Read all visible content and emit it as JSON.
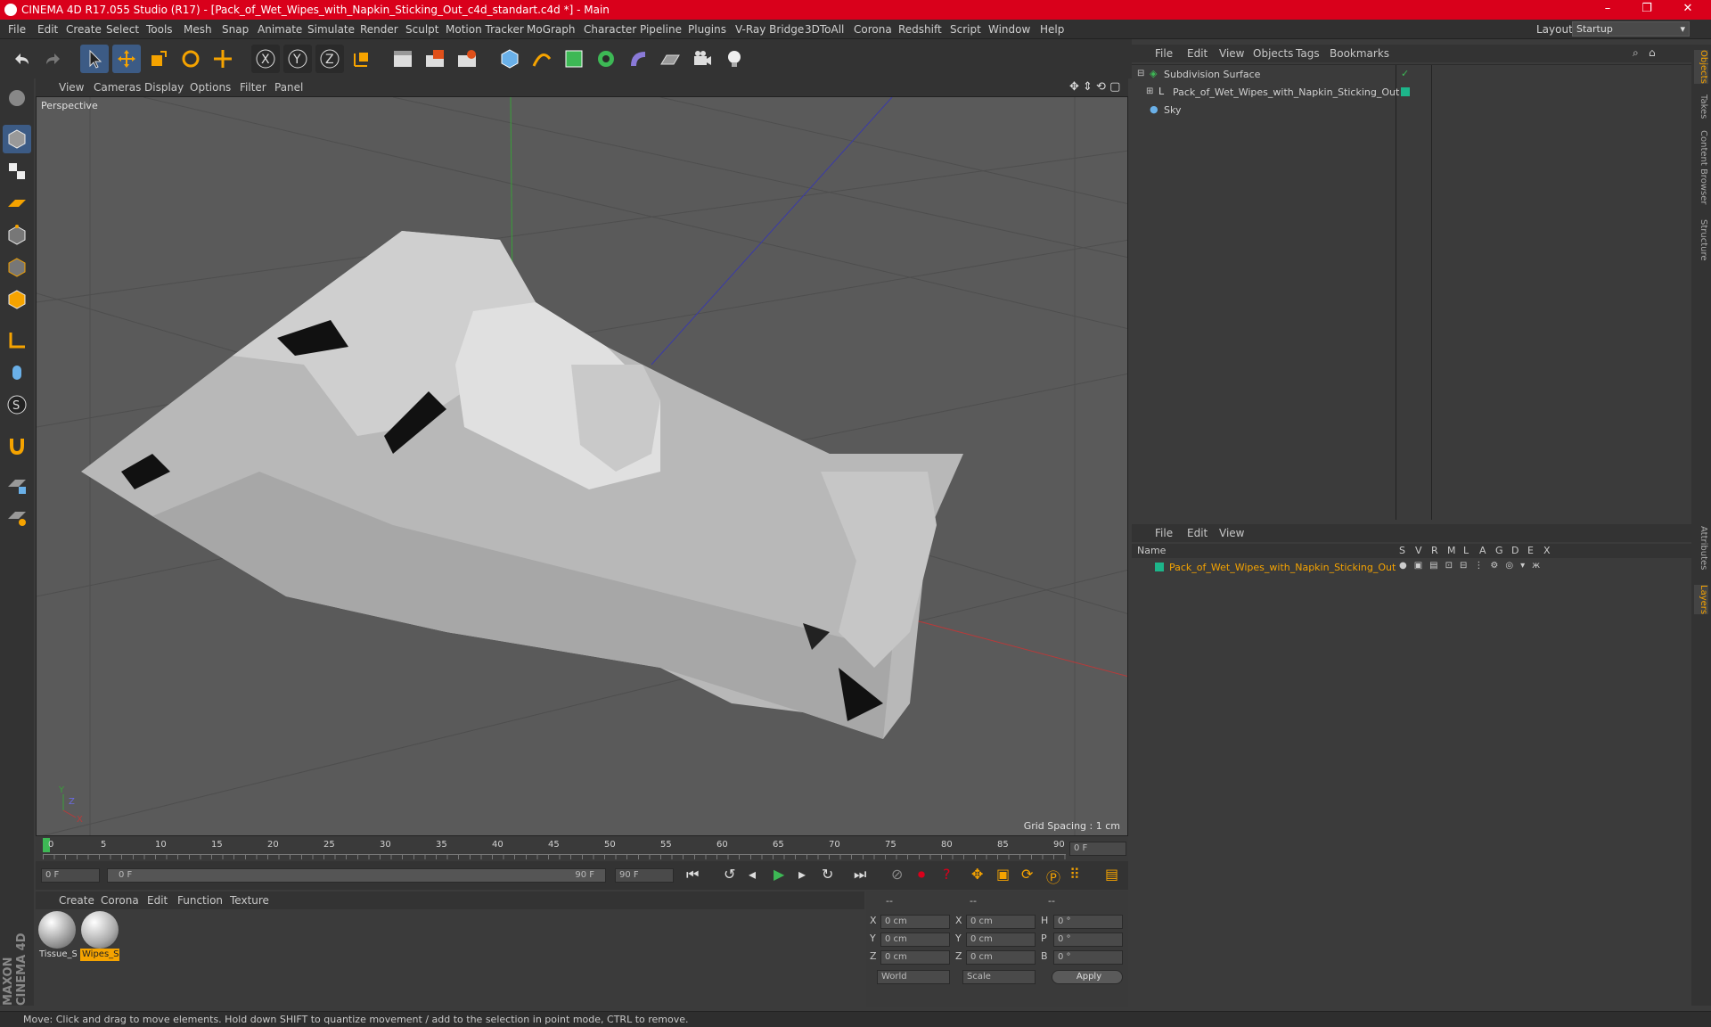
{
  "window": {
    "title": "CINEMA 4D R17.055 Studio (R17) - [Pack_of_Wet_Wipes_with_Napkin_Sticking_Out_c4d_standart.c4d *] - Main",
    "controls": [
      "–",
      "❐",
      "✕"
    ]
  },
  "menubar": {
    "items": [
      "File",
      "Edit",
      "Create",
      "Select",
      "Tools",
      "Mesh",
      "Snap",
      "Animate",
      "Simulate",
      "Render",
      "Sculpt",
      "Motion Tracker",
      "MoGraph",
      "Character",
      "Pipeline",
      "Plugins",
      "V-Ray Bridge",
      "3DToAll",
      "Corona",
      "Redshift",
      "Script",
      "Window",
      "Help"
    ],
    "layout_label": "Layout:",
    "layout_value": "Startup"
  },
  "viewport": {
    "menu": [
      "View",
      "Cameras",
      "Display",
      "Options",
      "Filter",
      "Panel"
    ],
    "label": "Perspective",
    "grid_spacing": "Grid Spacing : 1 cm"
  },
  "timeline": {
    "ticks": [
      "0",
      "5",
      "10",
      "15",
      "20",
      "25",
      "30",
      "35",
      "40",
      "45",
      "50",
      "55",
      "60",
      "65",
      "70",
      "75",
      "80",
      "85",
      "90"
    ],
    "current_frame": "0 F",
    "start_field": "0 F",
    "range_start": "0 F",
    "range_end": "90 F",
    "end_field": "90 F"
  },
  "materials": {
    "menu": [
      "Create",
      "Corona",
      "Edit",
      "Function",
      "Texture"
    ],
    "items": [
      {
        "label": "Tissue_S"
      },
      {
        "label": "Wipes_S"
      }
    ]
  },
  "coordinates": {
    "headers": [
      "--",
      "--",
      "--"
    ],
    "rows": [
      {
        "a": "X",
        "av": "0 cm",
        "b": "X",
        "bv": "0 cm",
        "c": "H",
        "cv": "0 °"
      },
      {
        "a": "Y",
        "av": "0 cm",
        "b": "Y",
        "bv": "0 cm",
        "c": "P",
        "cv": "0 °"
      },
      {
        "a": "Z",
        "av": "0 cm",
        "b": "Z",
        "bv": "0 cm",
        "c": "B",
        "cv": "0 °"
      }
    ],
    "mode1": "World",
    "mode2": "Scale",
    "apply": "Apply"
  },
  "object_manager": {
    "menu": [
      "File",
      "Edit",
      "View",
      "Objects",
      "Tags",
      "Bookmarks"
    ],
    "objects": [
      {
        "name": "Subdivision Surface"
      },
      {
        "name": "Pack_of_Wet_Wipes_with_Napkin_Sticking_Out"
      },
      {
        "name": "Sky"
      }
    ]
  },
  "layer_manager": {
    "menu": [
      "File",
      "Edit",
      "View"
    ],
    "columns": [
      "Name",
      "S",
      "V",
      "R",
      "M",
      "L",
      "A",
      "G",
      "D",
      "E",
      "X"
    ],
    "layers": [
      {
        "name": "Pack_of_Wet_Wipes_with_Napkin_Sticking_Out",
        "color": "#1db58a"
      }
    ]
  },
  "right_tabs": [
    "Objects",
    "Takes",
    "Content Browser",
    "Structure",
    "Attributes",
    "Layers"
  ],
  "status": "Move: Click and drag to move elements. Hold down SHIFT to quantize movement / add to the selection in point mode, CTRL to remove.",
  "brand": "MAXON CINEMA 4D",
  "colors": {
    "accent": "#f5a300",
    "titlebar": "#d9001b",
    "selected_tool": "#3c5b85"
  }
}
